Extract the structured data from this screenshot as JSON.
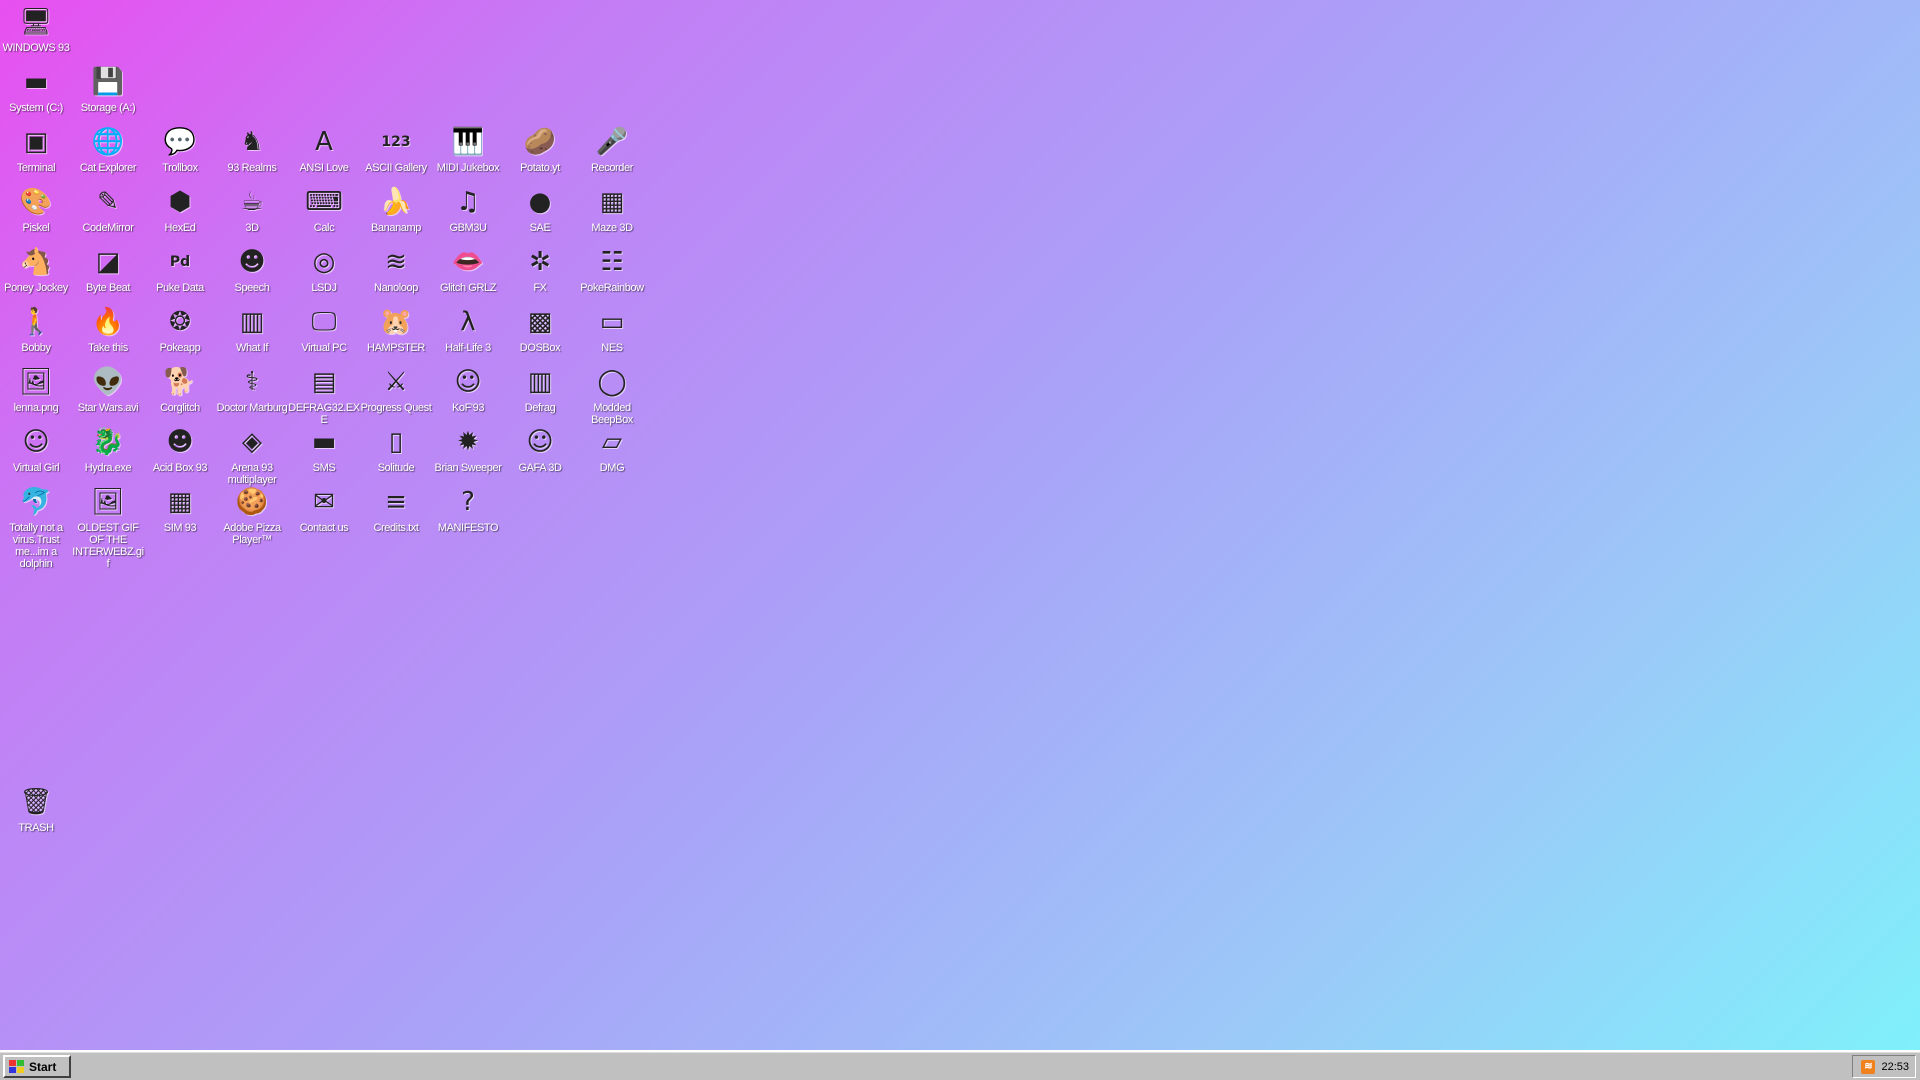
{
  "desktop": {
    "icons": [
      {
        "label": "WINDOWS 93",
        "glyph": "🖥",
        "icon": "computer-icon"
      },
      {
        "label": "System (C:)",
        "glyph": "▬",
        "icon": "hard-drive-icon"
      },
      {
        "label": "Storage (A:)",
        "glyph": "💾",
        "icon": "floppy-drive-icon"
      },
      {
        "label": "Terminal",
        "glyph": "▣",
        "icon": "terminal-icon"
      },
      {
        "label": "Cat Explorer",
        "glyph": "🌐",
        "icon": "globe-icon"
      },
      {
        "label": "Trollbox",
        "glyph": "💬",
        "icon": "chat-bubble-icon"
      },
      {
        "label": "93 Realms",
        "glyph": "♞",
        "icon": "realms-icon"
      },
      {
        "label": "ANSI Love",
        "glyph": "A",
        "icon": "ansi-icon"
      },
      {
        "label": "ASCII Gallery",
        "glyph": "123",
        "icon": "ascii-icon"
      },
      {
        "label": "MIDI Jukebox",
        "glyph": "🎹",
        "icon": "piano-icon"
      },
      {
        "label": "Potato.yt",
        "glyph": "🥔",
        "icon": "potato-icon"
      },
      {
        "label": "Recorder",
        "glyph": "🎤",
        "icon": "microphone-icon"
      },
      {
        "label": "Piskel",
        "glyph": "🎨",
        "icon": "palette-icon"
      },
      {
        "label": "CodeMirror",
        "glyph": "✎",
        "icon": "code-icon"
      },
      {
        "label": "HexEd",
        "glyph": "⬢",
        "icon": "hex-cube-icon"
      },
      {
        "label": "3D",
        "glyph": "☕",
        "icon": "teapot-icon"
      },
      {
        "label": "Calc",
        "glyph": "⌨",
        "icon": "calculator-icon"
      },
      {
        "label": "Bananamp",
        "glyph": "🍌",
        "icon": "banana-icon"
      },
      {
        "label": "GBM3U",
        "glyph": "♫",
        "icon": "music-file-icon"
      },
      {
        "label": "SAE",
        "glyph": "●",
        "icon": "checker-ball-icon"
      },
      {
        "label": "Maze 3D",
        "glyph": "▦",
        "icon": "maze-icon"
      },
      {
        "label": "Poney Jockey",
        "glyph": "🐴",
        "icon": "pony-icon"
      },
      {
        "label": "Byte Beat",
        "glyph": "◪",
        "icon": "bytebeat-icon"
      },
      {
        "label": "Puke Data",
        "glyph": "Pd",
        "icon": "pure-data-icon"
      },
      {
        "label": "Speech",
        "glyph": "☻",
        "icon": "speech-face-icon"
      },
      {
        "label": "LSDJ",
        "glyph": "◎",
        "icon": "lsdj-icon"
      },
      {
        "label": "Nanoloop",
        "glyph": "≋",
        "icon": "waveform-icon"
      },
      {
        "label": "Glitch GRLZ",
        "glyph": "👄",
        "icon": "lips-icon"
      },
      {
        "label": "FX",
        "glyph": "✲",
        "icon": "fx-star-icon"
      },
      {
        "label": "PokeRainbow",
        "glyph": "☷",
        "icon": "pokemon-group-icon"
      },
      {
        "label": "Bobby",
        "glyph": "🚶",
        "icon": "stick-figure-icon"
      },
      {
        "label": "Take this",
        "glyph": "🔥",
        "icon": "fire-creature-icon"
      },
      {
        "label": "Pokeapp",
        "glyph": "❂",
        "icon": "pokeapp-icon"
      },
      {
        "label": "What If",
        "glyph": "▥",
        "icon": "what-if-icon"
      },
      {
        "label": "Virtual PC",
        "glyph": "🖵",
        "icon": "virtual-pc-icon"
      },
      {
        "label": "HAMPSTER",
        "glyph": "🐹",
        "icon": "hamster-icon"
      },
      {
        "label": "Half-Life 3",
        "glyph": "λ",
        "icon": "lambda-icon"
      },
      {
        "label": "DOSBox",
        "glyph": "▩",
        "icon": "dosbox-icon"
      },
      {
        "label": "NES",
        "glyph": "▭",
        "icon": "nes-console-icon"
      },
      {
        "label": "lenna.png",
        "glyph": "🖼",
        "icon": "image-file-icon"
      },
      {
        "label": "Star Wars.avi",
        "glyph": "👽",
        "icon": "yoda-icon"
      },
      {
        "label": "Corglitch",
        "glyph": "🐕",
        "icon": "corgi-icon"
      },
      {
        "label": "Doctor Marburg",
        "glyph": "⚕",
        "icon": "doctor-icon"
      },
      {
        "label": "DEFRAG32.EXE",
        "glyph": "▤",
        "icon": "old-pc-icon"
      },
      {
        "label": "Progress Quest",
        "glyph": "⚔",
        "icon": "crossed-swords-icon"
      },
      {
        "label": "KoF'93",
        "glyph": "☺",
        "icon": "fighter-face-icon"
      },
      {
        "label": "Defrag",
        "glyph": "▥",
        "icon": "defrag-icon"
      },
      {
        "label": "Modded BeepBox",
        "glyph": "◯",
        "icon": "beepbox-ring-icon"
      },
      {
        "label": "Virtual Girl",
        "glyph": "☺",
        "icon": "portrait-icon"
      },
      {
        "label": "Hydra.exe",
        "glyph": "🐉",
        "icon": "hydra-icon"
      },
      {
        "label": "Acid Box 93",
        "glyph": "☻",
        "icon": "smiley-icon"
      },
      {
        "label": "Arena 93 multiplayer",
        "glyph": "◈",
        "icon": "cube-icon"
      },
      {
        "label": "SMS",
        "glyph": "▬",
        "icon": "sms-console-icon"
      },
      {
        "label": "Solitude",
        "glyph": "▯",
        "icon": "solitude-icon"
      },
      {
        "label": "Brian Sweeper",
        "glyph": "✹",
        "icon": "mine-icon"
      },
      {
        "label": "GAFA 3D",
        "glyph": "☺",
        "icon": "gafa-face-icon"
      },
      {
        "label": "DMG",
        "glyph": "▱",
        "icon": "gameboy-icon"
      },
      {
        "label": "Totally not a virus.Trust me...im a dolphin",
        "glyph": "🐬",
        "icon": "dolphin-icon"
      },
      {
        "label": "OLDEST GIF OF THE INTERWEBZ.gif",
        "glyph": "🖼",
        "icon": "gif-file-icon"
      },
      {
        "label": "SIM 93",
        "glyph": "▦",
        "icon": "sim-icon"
      },
      {
        "label": "Adobe Pizza Player™",
        "glyph": "🍪",
        "icon": "cookie-pizza-icon"
      },
      {
        "label": "Contact us",
        "glyph": "✉",
        "icon": "contact-icon"
      },
      {
        "label": "Credits.txt",
        "glyph": "≡",
        "icon": "text-file-icon"
      },
      {
        "label": "MANIFESTO",
        "glyph": "?",
        "icon": "question-mark-icon"
      },
      {
        "label": "TRASH",
        "glyph": "🗑",
        "icon": "trash-icon"
      }
    ]
  },
  "taskbar": {
    "start_label": "Start",
    "clock": "22:53",
    "rss_glyph": "≋"
  },
  "colors": {
    "gradient_start": "#e84ff0",
    "gradient_end": "#7ef2fb",
    "taskbar": "#c0c0c0"
  }
}
